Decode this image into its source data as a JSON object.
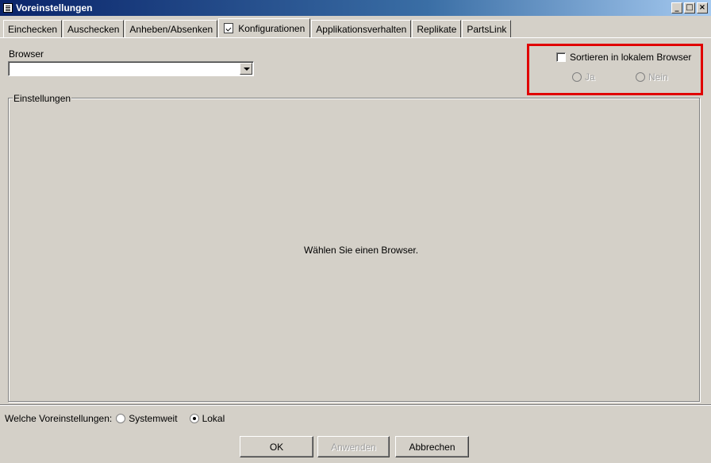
{
  "window": {
    "title": "Voreinstellungen",
    "minimize": "_",
    "maximize": "□",
    "close": "×"
  },
  "tabs": [
    {
      "label": "Einchecken"
    },
    {
      "label": "Auschecken"
    },
    {
      "label": "Anheben/Absenken"
    },
    {
      "label": "Konfigurationen"
    },
    {
      "label": "Applikationsverhalten"
    },
    {
      "label": "Replikate"
    },
    {
      "label": "PartsLink"
    }
  ],
  "active_tab": "Konfigurationen",
  "browser": {
    "label": "Browser",
    "selected": ""
  },
  "sort": {
    "checkbox_label": "Sortieren in lokalem Browser",
    "checked": false,
    "yes_label": "Ja",
    "no_label": "Nein"
  },
  "settings_group": {
    "label": "Einstellungen",
    "empty_message": "Wählen Sie einen Browser."
  },
  "scope": {
    "label": "Welche Voreinstellungen:",
    "options": [
      "Systemweit",
      "Lokal"
    ],
    "selected": "Lokal"
  },
  "buttons": {
    "ok": "OK",
    "apply": "Anwenden",
    "cancel": "Abbrechen"
  },
  "colors": {
    "highlight": "#e00000",
    "dialog_bg": "#d4d0c8"
  }
}
